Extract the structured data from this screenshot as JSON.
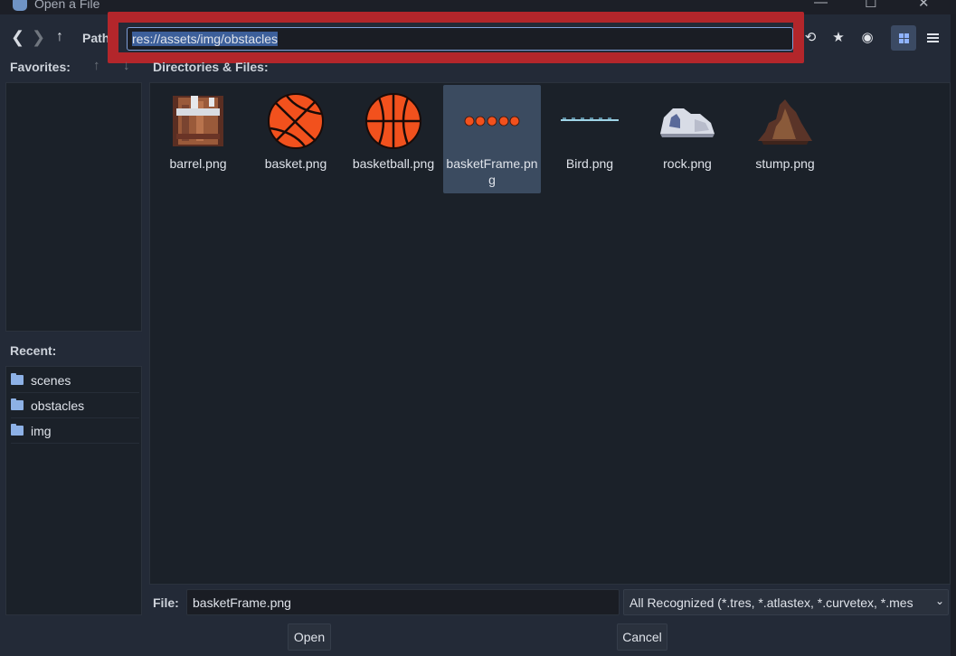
{
  "window": {
    "title": "Open a File",
    "controls": {
      "minimize": "—",
      "maximize": "☐",
      "close": "✕"
    }
  },
  "toolbar": {
    "back_icon": "❮",
    "forward_icon": "❯",
    "up_icon": "↑",
    "path_label": "Path:",
    "path_value": "res://assets/img/obstacles",
    "refresh_icon": "⟲",
    "favorite_icon": "★",
    "show_hidden_icon": "◉",
    "view_grid_active": true,
    "highlight_color": "#b3262b"
  },
  "favorites": {
    "label": "Favorites:",
    "move_up_icon": "↑",
    "move_down_icon": "↓",
    "items": []
  },
  "recent": {
    "label": "Recent:",
    "items": [
      {
        "label": "scenes",
        "icon": "folder-icon"
      },
      {
        "label": "obstacles",
        "icon": "folder-icon"
      },
      {
        "label": "img",
        "icon": "folder-icon"
      }
    ]
  },
  "files": {
    "label": "Directories & Files:",
    "items": [
      {
        "name": "barrel.png",
        "thumb": "barrel",
        "selected": false
      },
      {
        "name": "basket.png",
        "thumb": "basket",
        "selected": false
      },
      {
        "name": "basketball.png",
        "thumb": "basketball",
        "selected": false
      },
      {
        "name": "basketFrame.png",
        "thumb": "basketframe",
        "selected": true
      },
      {
        "name": "Bird.png",
        "thumb": "bird",
        "selected": false
      },
      {
        "name": "rock.png",
        "thumb": "rock",
        "selected": false
      },
      {
        "name": "stump.png",
        "thumb": "stump",
        "selected": false
      }
    ]
  },
  "footer": {
    "file_label": "File:",
    "file_value": "basketFrame.png",
    "filter_value": "All Recognized (*.tres, *.atlastex, *.curvetex, *.mes",
    "filter_chevron": "⌄",
    "open_label": "Open",
    "cancel_label": "Cancel"
  },
  "colors": {
    "background": "#232a37",
    "panel": "#1b2129",
    "selection": "#3b4b60",
    "accent": "#8fb3ff"
  }
}
